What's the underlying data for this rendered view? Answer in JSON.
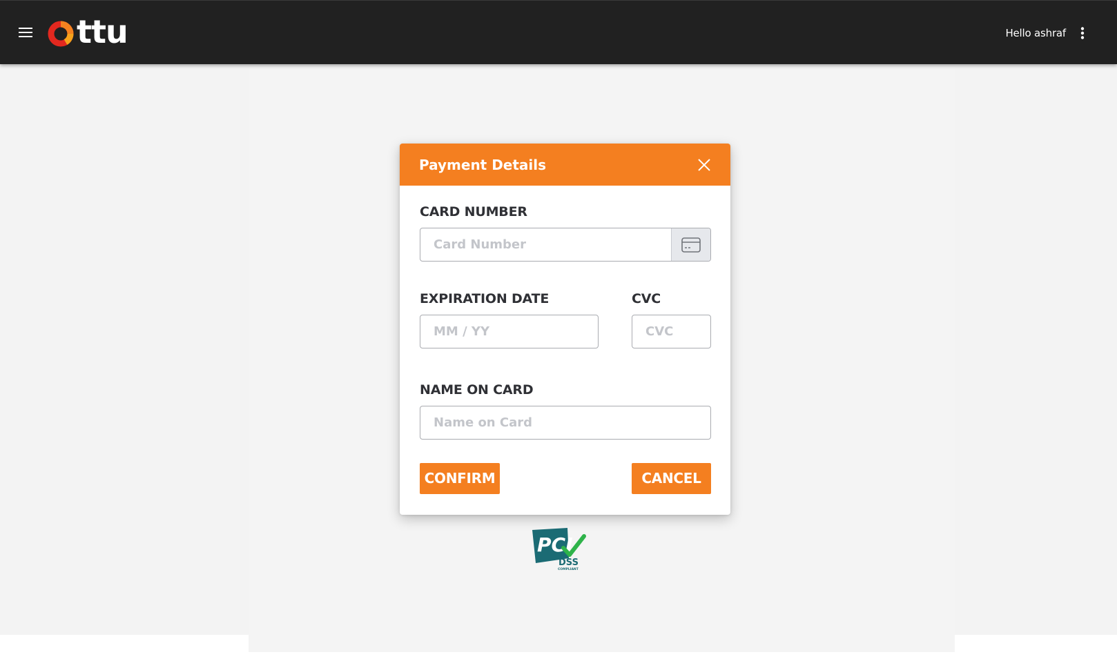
{
  "app_bar": {
    "logo_text": "ttu",
    "greeting": "Hello ashraf"
  },
  "modal": {
    "title": "Payment Details",
    "card_number": {
      "label": "CARD NUMBER",
      "placeholder": "Card Number",
      "value": ""
    },
    "expiration": {
      "label": "EXPIRATION DATE",
      "placeholder": "MM / YY",
      "value": ""
    },
    "cvc": {
      "label": "CVC",
      "placeholder": "CVC",
      "value": ""
    },
    "name_on_card": {
      "label": "NAME ON CARD",
      "placeholder": "Name on Card",
      "value": ""
    },
    "confirm_label": "CONFIRM",
    "cancel_label": "CANCEL"
  },
  "badge": {
    "pci_text": "PCI",
    "dss_text": "DSS",
    "compliant_text": "COMPLIANT"
  },
  "icons": {
    "menu": "hamburger-icon",
    "more": "vertical-dots-icon",
    "close": "close-icon",
    "card": "credit-card-icon"
  },
  "colors": {
    "app_bar": "#212121",
    "accent": "#f47f20",
    "logo_ring_red": "#e3281f",
    "logo_ring_orange": "#f5821f",
    "pci_teal": "#1b6b74",
    "pci_green": "#2fb34a",
    "background": "#f3f3f3"
  }
}
